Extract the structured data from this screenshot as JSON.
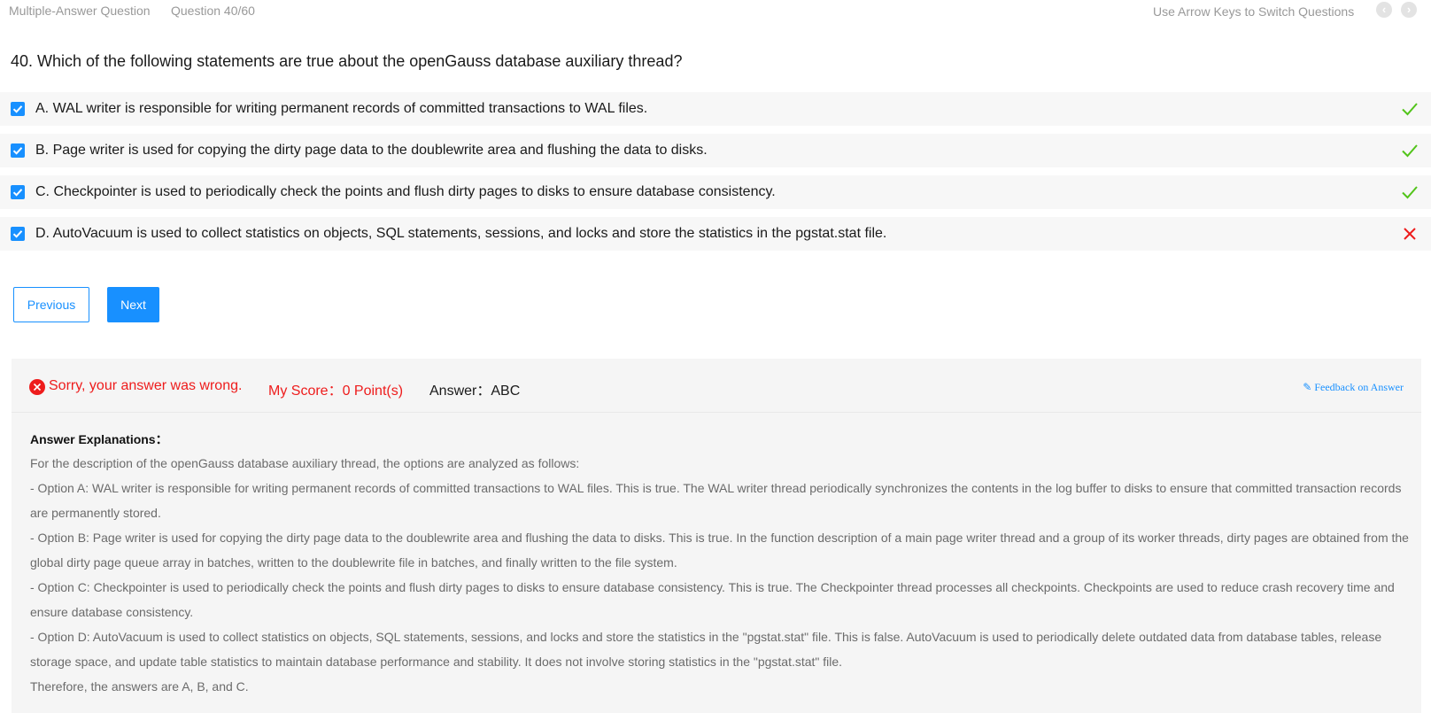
{
  "header": {
    "question_type": "Multiple-Answer Question",
    "question_counter": "Question 40/60",
    "nav_hint": "Use Arrow Keys to Switch Questions",
    "prev_icon": "chevron-left-icon",
    "next_icon": "chevron-right-icon"
  },
  "question": {
    "text": "40. Which of the following statements are true about the openGauss database auxiliary thread?"
  },
  "options": [
    {
      "label": "A. WAL writer is responsible for writing permanent records of committed transactions to WAL files.",
      "checked": true,
      "result": "correct"
    },
    {
      "label": "B. Page writer is used for copying the dirty page data to the doublewrite area and flushing the data to disks.",
      "checked": true,
      "result": "correct"
    },
    {
      "label": "C. Checkpointer is used to periodically check the points and flush dirty pages to disks to ensure database consistency.",
      "checked": true,
      "result": "correct"
    },
    {
      "label": "D. AutoVacuum is used to collect statistics on objects, SQL statements, sessions, and locks and store the statistics in the pgstat.stat file.",
      "checked": true,
      "result": "wrong"
    }
  ],
  "buttons": {
    "previous": "Previous",
    "next": "Next"
  },
  "result": {
    "status": "Sorry, your answer was wrong.",
    "score": "My Score：0 Point(s)",
    "answer": "Answer：ABC",
    "feedback": "✎ Feedback on Answer"
  },
  "explanation": {
    "heading": "Answer Explanations：",
    "lines": [
      "For the description of the openGauss database auxiliary thread, the options are analyzed as follows:",
      "- Option A: WAL writer is responsible for writing permanent records of committed transactions to WAL files. This is true. The WAL writer thread periodically synchronizes the contents in the log buffer to disks to ensure that committed transaction records are permanently stored.",
      "- Option B: Page writer is used for copying the dirty page data to the doublewrite area and flushing the data to disks. This is true. In the function description of a main page writer thread and a group of its worker threads, dirty pages are obtained from the global dirty page queue array in batches, written to the doublewrite file in batches, and finally written to the file system.",
      "- Option C: Checkpointer is used to periodically check the points and flush dirty pages to disks to ensure database consistency. This is true. The Checkpointer thread processes all checkpoints. Checkpoints are used to reduce crash recovery time and ensure database consistency.",
      "- Option D: AutoVacuum is used to collect statistics on objects, SQL statements, sessions, and locks and store the statistics in the \"pgstat.stat\" file. This is false. AutoVacuum is used to periodically delete outdated data from database tables, release storage space, and update table statistics to maintain database performance and stability. It does not involve storing statistics in the \"pgstat.stat\" file.",
      "Therefore, the answers are A, B, and C."
    ]
  },
  "colors": {
    "accent": "#1890ff",
    "correct": "#52c41a",
    "wrong": "#ee1c1c",
    "panel_bg": "#f5f5f5",
    "option_bg": "#f7f7f7"
  }
}
